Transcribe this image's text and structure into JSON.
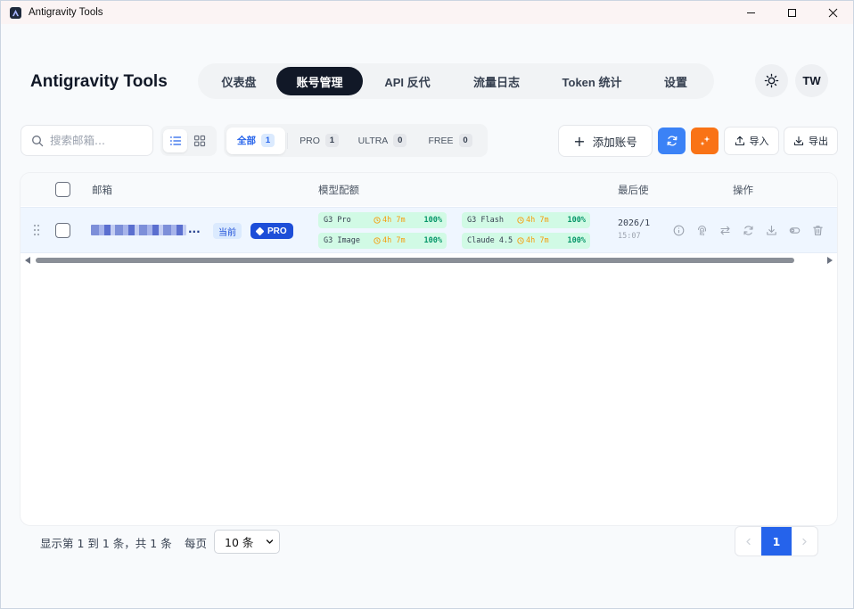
{
  "window": {
    "title": "Antigravity Tools",
    "controls": [
      "minimize",
      "maximize",
      "close"
    ]
  },
  "header": {
    "brand": "Antigravity Tools",
    "nav": [
      {
        "label": "仪表盘",
        "active": false
      },
      {
        "label": "账号管理",
        "active": true
      },
      {
        "label": "API 反代",
        "active": false
      },
      {
        "label": "流量日志",
        "active": false
      },
      {
        "label": "Token 统计",
        "active": false
      },
      {
        "label": "设置",
        "active": false
      }
    ],
    "theme_icon": "sun-icon",
    "avatar": "TW"
  },
  "toolbar": {
    "search_placeholder": "搜索邮箱...",
    "view_modes": [
      "list-view",
      "grid-view"
    ],
    "active_view": "list-view",
    "filters": [
      {
        "label": "全部",
        "count": "1",
        "active": true
      },
      {
        "label": "PRO",
        "count": "1",
        "active": false
      },
      {
        "label": "ULTRA",
        "count": "0",
        "active": false
      },
      {
        "label": "FREE",
        "count": "0",
        "active": false
      }
    ],
    "add_label": "添加账号",
    "import_label": "导入",
    "export_label": "导出",
    "accent_blue": "#3b82f6",
    "accent_orange": "#f97316"
  },
  "table": {
    "columns": {
      "email": "邮箱",
      "quota": "模型配额",
      "last_used": "最后使",
      "actions": "操作"
    },
    "rows": [
      {
        "email": "...",
        "current_badge": "当前",
        "tier_badge": "PRO",
        "quotas": [
          {
            "name": "G3 Pro",
            "reset": "4h 7m",
            "percent": "100%"
          },
          {
            "name": "G3 Flash",
            "reset": "4h 7m",
            "percent": "100%"
          },
          {
            "name": "G3 Image",
            "reset": "4h 7m",
            "percent": "100%"
          },
          {
            "name": "Claude 4.5",
            "reset": "4h 7m",
            "percent": "100%"
          }
        ],
        "last_used_date": "2026/1",
        "last_used_time": "15:07",
        "actions": [
          "info-icon",
          "fingerprint-icon",
          "switch-icon",
          "refresh-icon",
          "download-icon",
          "toggle-icon",
          "trash-icon"
        ]
      }
    ]
  },
  "footer": {
    "summary": "显示第 1 到 1 条，共 1 条",
    "per_page_label": "每页",
    "page_size": "10 条",
    "current_page": "1"
  }
}
